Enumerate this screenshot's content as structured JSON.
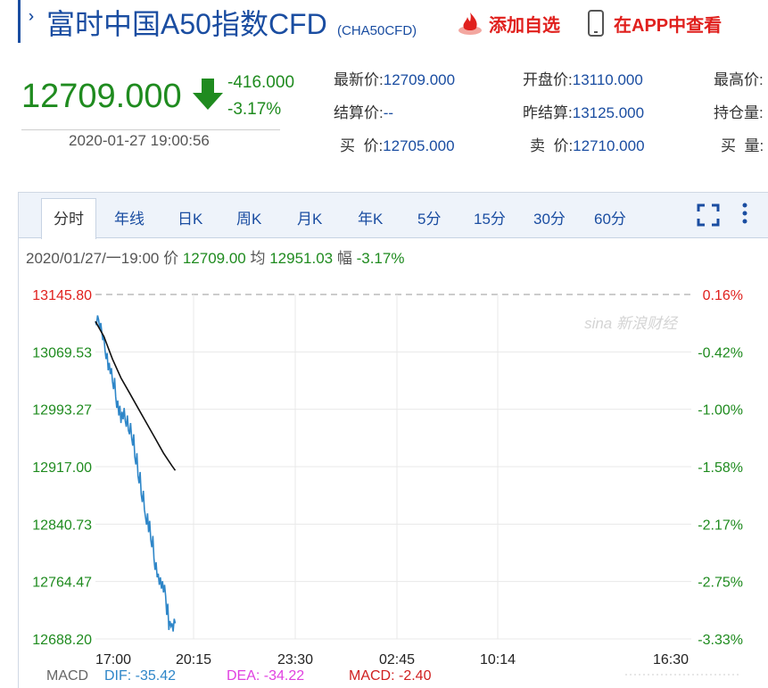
{
  "header": {
    "title": "富时中国A50指数CFD",
    "subtitle": "(CHA50CFD)",
    "add_favorite": "添加自选",
    "view_in_app": "在APP中查看"
  },
  "quote": {
    "price": "12709.000",
    "change": "-416.000",
    "change_pct": "-3.17%",
    "datetime": "2020-01-27 19:00:56",
    "fields": [
      {
        "label": "最新价:",
        "value": "12709.000"
      },
      {
        "label": "开盘价:",
        "value": "13110.000"
      },
      {
        "label": "最高价:",
        "value": ""
      },
      {
        "label": "结算价:",
        "value": "--"
      },
      {
        "label": "昨结算:",
        "value": "13125.000"
      },
      {
        "label": "持仓量:",
        "value": ""
      },
      {
        "label": "买  价:",
        "value": "12705.000"
      },
      {
        "label": "卖  价:",
        "value": "12710.000"
      },
      {
        "label": "买  量:",
        "value": ""
      }
    ]
  },
  "tabs": [
    "分时",
    "年线",
    "日K",
    "周K",
    "月K",
    "年K",
    "5分",
    "15分",
    "30分",
    "60分"
  ],
  "info": {
    "date": "2020/01/27/一19:00",
    "price_label": "价",
    "price": "12709.00",
    "avg_label": "均",
    "avg": "12951.03",
    "amp_label": "幅",
    "amp": "-3.17%"
  },
  "watermark": "sina 新浪财经",
  "macd": {
    "label": "MACD",
    "dif": "DIF: -35.42",
    "dea": "DEA: -34.22",
    "macd": "MACD: -2.40"
  },
  "colors": {
    "up": "#e0201d",
    "down": "#1f8b1f",
    "link": "#1a4da1",
    "price_line": "#2e86c8",
    "avg_line": "#111111",
    "dea": "#e040e0",
    "macd": "#d02020"
  },
  "chart_data": {
    "type": "line",
    "y_ticks_left": [
      "13145.80",
      "13069.53",
      "12993.27",
      "12917.00",
      "12840.73",
      "12764.47",
      "12688.20"
    ],
    "y_ticks_right": [
      "0.16%",
      "-0.42%",
      "-1.00%",
      "-1.58%",
      "-2.17%",
      "-2.75%",
      "-3.33%"
    ],
    "x_ticks": [
      "17:00",
      "20:15",
      "23:30",
      "02:45",
      "10:14",
      "16:30"
    ],
    "ylim": [
      12688.2,
      13145.8
    ],
    "reference_line": 13125.0,
    "series": [
      {
        "role": "price",
        "x": [
          0,
          1,
          2,
          3,
          4,
          5,
          6,
          7,
          8,
          9,
          10,
          11,
          12,
          13,
          14,
          15,
          16,
          17,
          18,
          19,
          20,
          21,
          22,
          23,
          24,
          25,
          26,
          27,
          28,
          29,
          30,
          31,
          32,
          33,
          34,
          35,
          36,
          37,
          38,
          39,
          40,
          41,
          42,
          43,
          44,
          45,
          46,
          47,
          48,
          49,
          50,
          51,
          52,
          53,
          54,
          55,
          56,
          57,
          58,
          59,
          60,
          61,
          62,
          63,
          64,
          65,
          66,
          67,
          68,
          69,
          70,
          71,
          72,
          73,
          74,
          75
        ],
        "values": [
          13110,
          13105,
          13118,
          13112,
          13100,
          13108,
          13095,
          13085,
          13090,
          13072,
          13060,
          13068,
          13045,
          13055,
          13040,
          13048,
          13030,
          13020,
          13035,
          13010,
          12995,
          13005,
          12985,
          12998,
          12975,
          12990,
          12980,
          12995,
          12978,
          12970,
          12985,
          12965,
          12960,
          12975,
          12955,
          12945,
          12960,
          12930,
          12920,
          12935,
          12905,
          12895,
          12910,
          12880,
          12870,
          12885,
          12860,
          12850,
          12840,
          12855,
          12830,
          12845,
          12820,
          12810,
          12825,
          12795,
          12780,
          12790,
          12770,
          12775,
          12760,
          12770,
          12755,
          12765,
          12750,
          12760,
          12745,
          12720,
          12735,
          12700,
          12712,
          12705,
          12709,
          12698,
          12715,
          12709
        ]
      },
      {
        "role": "average",
        "x": [
          0,
          8,
          16,
          24,
          32,
          40,
          48,
          56,
          64,
          72,
          75
        ],
        "values": [
          13110,
          13090,
          13060,
          13035,
          13015,
          12995,
          12975,
          12955,
          12935,
          12918,
          12912
        ]
      }
    ],
    "x_range": [
      0,
      560
    ]
  }
}
